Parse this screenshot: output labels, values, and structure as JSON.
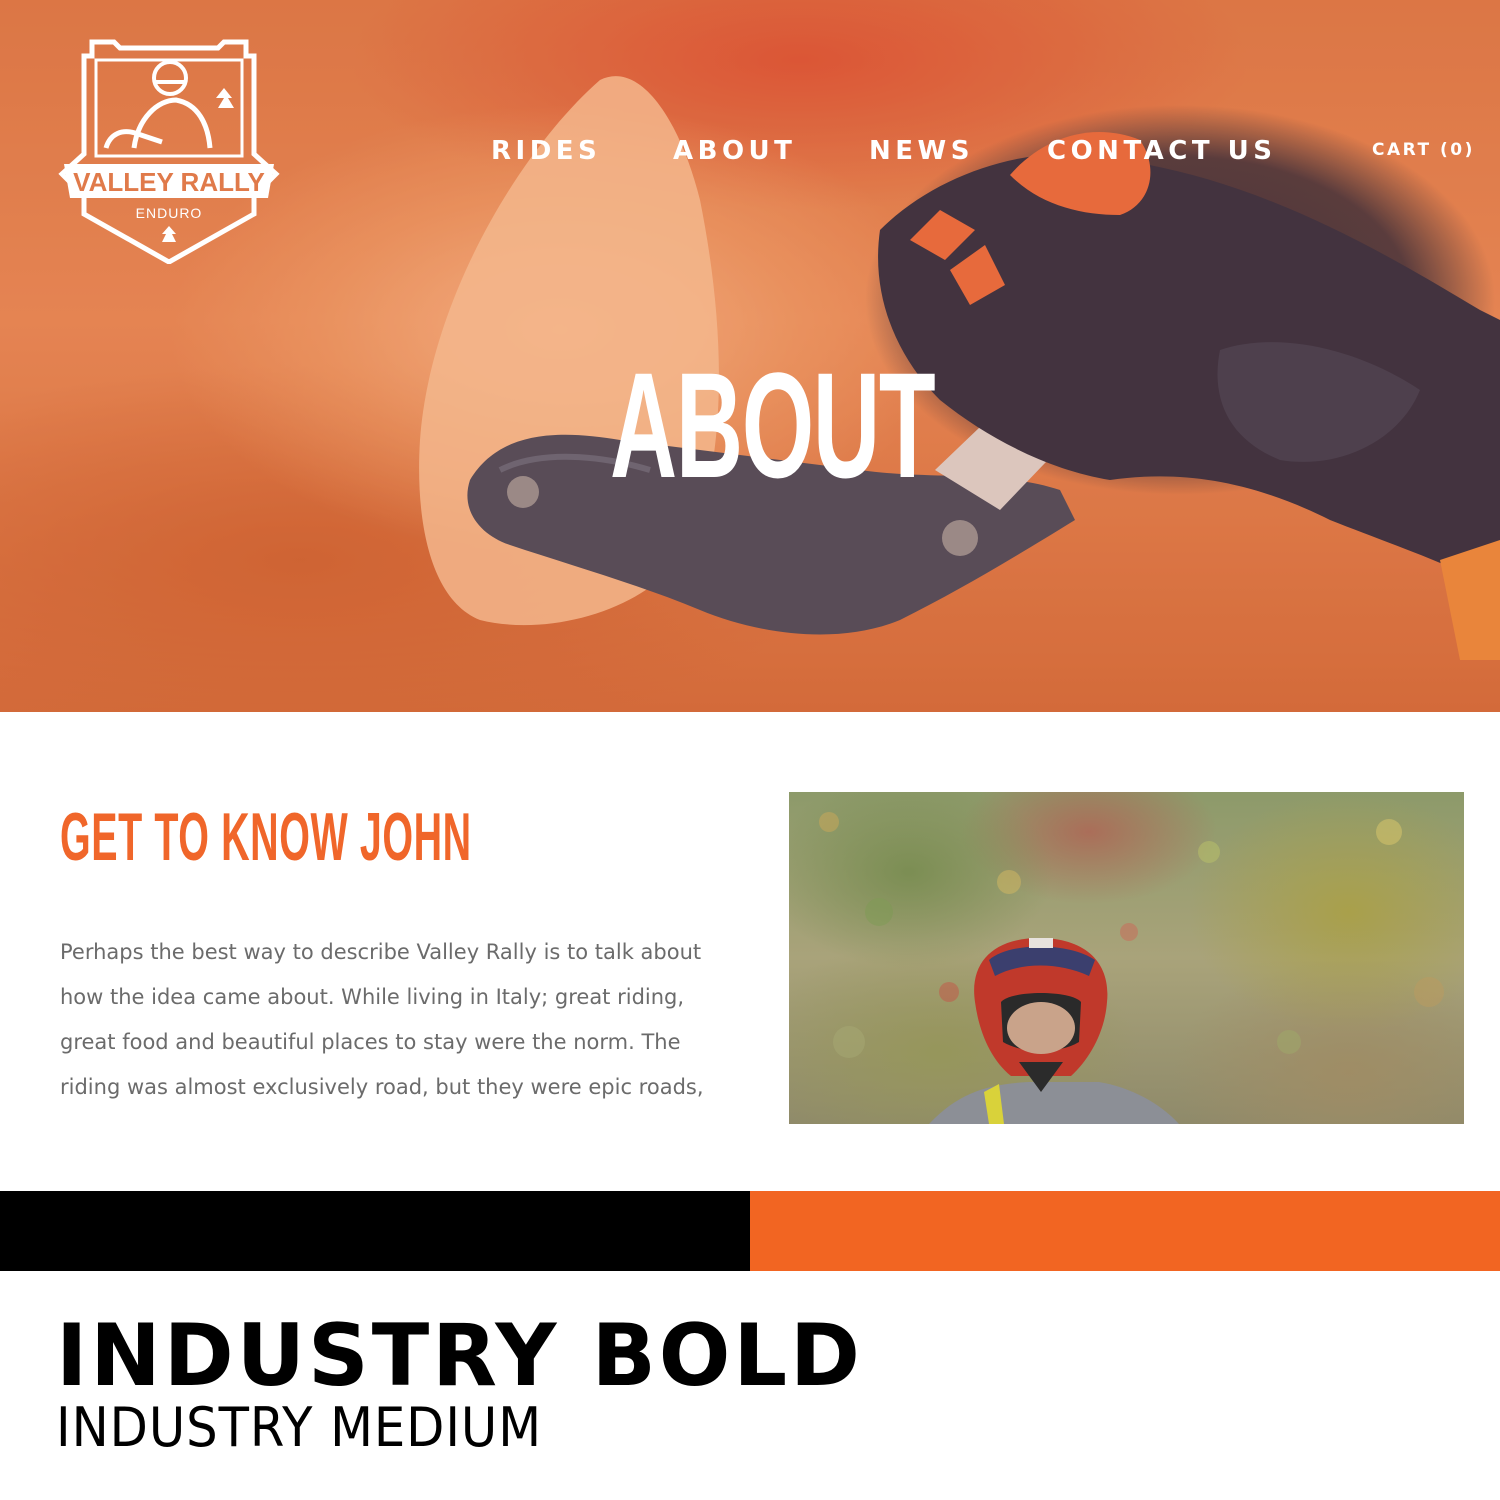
{
  "brand": {
    "name": "VALLEY RALLY",
    "sub": "ENDURO",
    "accent_color": "#f26522",
    "logo_icon": "rider-shield-logo"
  },
  "nav": {
    "items": [
      "RIDES",
      "ABOUT",
      "NEWS",
      "CONTACT US"
    ],
    "cart": "CART (0)"
  },
  "hero": {
    "title": "ABOUT"
  },
  "about": {
    "heading": "GET TO KNOW JOHN",
    "body": "Perhaps the best way to describe Valley Rally is to talk about how the idea came about. While living in Italy; great riding, great food and beautiful places to stay were the norm. The riding was almost exclusively road, but they were epic roads,"
  },
  "colors": {
    "bar_left": "#000000",
    "bar_right": "#f26522"
  },
  "typography": {
    "bold_sample": "INDUSTRY BOLD",
    "medium_sample": "INDUSTRY MEDIUM"
  }
}
